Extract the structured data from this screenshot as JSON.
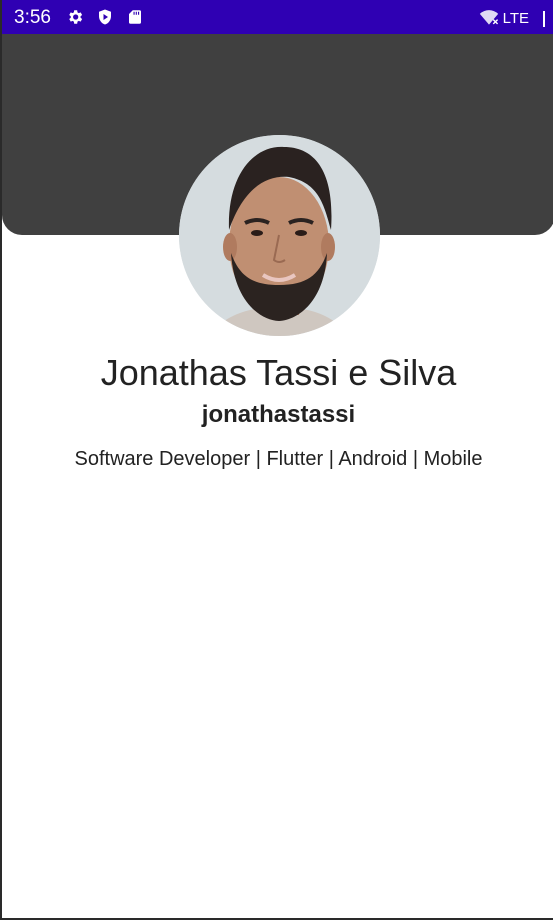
{
  "status_bar": {
    "time": "3:56",
    "network_label": "LTE",
    "background_color": "#2f00b3",
    "icons": [
      "settings-gear-icon",
      "play-protect-icon",
      "sd-card-icon",
      "wifi-off-icon",
      "signal-icon"
    ]
  },
  "header": {
    "background_color": "#404040"
  },
  "profile": {
    "name": "Jonathas Tassi e Silva",
    "username": "jonathastassi",
    "bio": "Software Developer | Flutter | Android | Mobile"
  }
}
